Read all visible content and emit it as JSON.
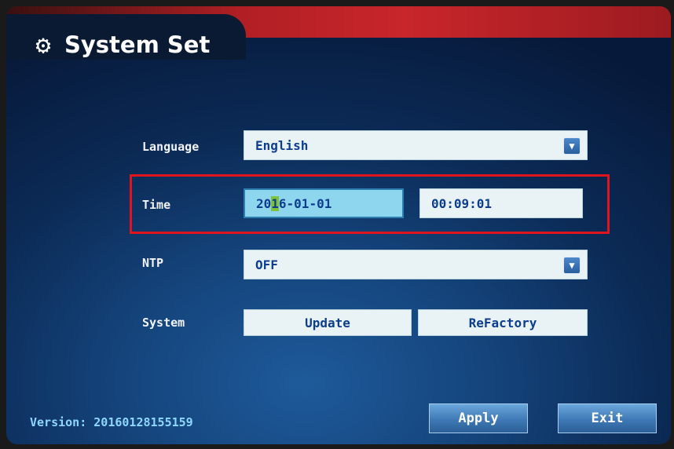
{
  "header": {
    "title": "System Set",
    "icon": "gear-icon"
  },
  "language": {
    "label": "Language",
    "value": "English"
  },
  "time": {
    "label": "Time",
    "date_before_cursor": "20",
    "date_cursor_char": "1",
    "date_after_cursor": "6-01-01",
    "clock": "00:09:01"
  },
  "ntp": {
    "label": "NTP",
    "value": "OFF"
  },
  "system": {
    "label": "System",
    "update_label": "Update",
    "refactory_label": "ReFactory"
  },
  "footer": {
    "version": "Version: 20160128155159",
    "apply_label": "Apply",
    "exit_label": "Exit"
  },
  "colors": {
    "accent": "#c8262b",
    "highlight": "#e0141c",
    "field_bg": "#e9f3f6",
    "active_field_bg": "#8ed6ee",
    "text": "#0d3d8e"
  }
}
